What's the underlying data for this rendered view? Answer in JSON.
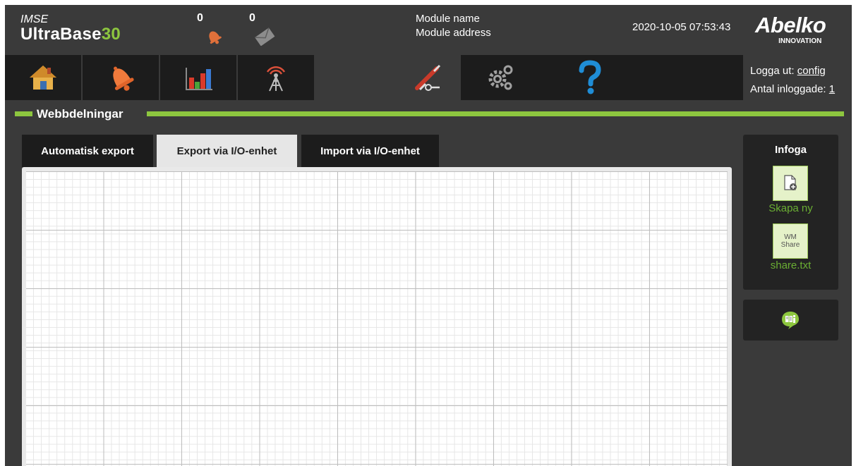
{
  "header": {
    "brand_small": "IMSE",
    "brand_name": "UltraBase",
    "brand_number": "30",
    "alarm_count": "0",
    "message_count": "0",
    "module_name": "Module name",
    "module_address": "Module address",
    "datetime": "2020-10-05 07:53:43",
    "logo_name": "Abelko",
    "logo_sub": "INNOVATION"
  },
  "nav": {
    "items": [
      {
        "icon": "home-icon"
      },
      {
        "icon": "bell-icon"
      },
      {
        "icon": "bar-chart-icon"
      },
      {
        "icon": "antenna-icon"
      },
      {
        "icon": "tools-icon",
        "active": true
      },
      {
        "icon": "gears-icon"
      },
      {
        "icon": "help-icon"
      }
    ],
    "logout_label": "Logga ut:",
    "logout_user": "config",
    "logged_in_label": "Antal inloggade:",
    "logged_in_count": "1"
  },
  "section": {
    "title": "Webbdelningar"
  },
  "tabs": [
    {
      "label": "Automatisk export",
      "active": false
    },
    {
      "label": "Export via I/O-enhet",
      "active": true
    },
    {
      "label": "Import via I/O-enhet",
      "active": false
    }
  ],
  "sidebar": {
    "title": "Infoga",
    "create_label": "Skapa ny",
    "share_icon_line1": "WM",
    "share_icon_line2": "Share",
    "share_label": "share.txt"
  },
  "colors": {
    "accent": "#8dc63f",
    "background": "#3a3a3a",
    "tab_bg": "#1c1c1c",
    "tab_active_bg": "#e6e6e6",
    "bell": "#f07a3c",
    "help": "#1f8dd6"
  }
}
